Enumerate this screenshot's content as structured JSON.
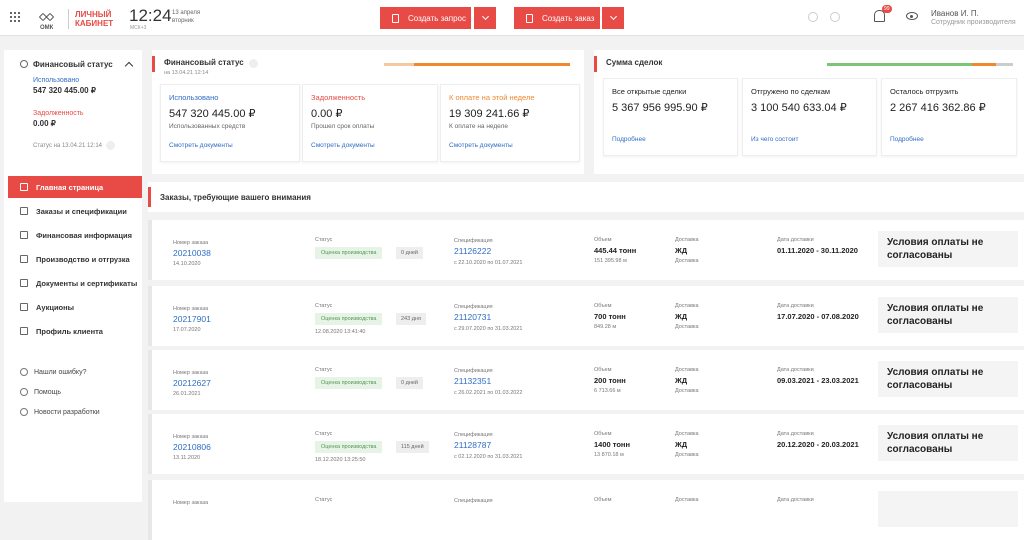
{
  "header": {
    "logo_text": "ОМК",
    "logo_title_line1": "ЛИЧНЫЙ",
    "logo_title_line2": "КАБИНЕТ",
    "time": "12:24",
    "date_line1": "13 апреля",
    "date_line2": "вторник",
    "timezone": "МСК+3",
    "create_request": "Создать запрос",
    "create_order": "Создать заказ",
    "notif_count": "99",
    "user_name": "Иванов И. П.",
    "user_role": "Сотрудник производителя",
    "accent": "#e84a45"
  },
  "sidebar": {
    "fin_title": "Финансовый статус",
    "used_label": "Использовано",
    "used_value": "547 320 445.00 ₽",
    "debt_label": "Задолженность",
    "debt_value": "0.00 ₽",
    "status_text": "Статус на 13.04.21 12:14",
    "nav": [
      {
        "label": "Главная страница"
      },
      {
        "label": "Заказы и спецификации"
      },
      {
        "label": "Финансовая информация"
      },
      {
        "label": "Производство и отгрузка"
      },
      {
        "label": "Документы и сертификаты"
      },
      {
        "label": "Аукционы"
      },
      {
        "label": "Профиль клиента"
      }
    ],
    "secondary": [
      {
        "label": "Нашли ошибку?"
      },
      {
        "label": "Помощь"
      },
      {
        "label": "Новости разработки"
      }
    ]
  },
  "fin_card": {
    "title": "Финансовый статус",
    "subtitle": "на 13.04.21 12:14",
    "blocks": [
      {
        "label": "Использовано",
        "value": "547 320 445.00 ₽",
        "desc": "Использованных средств",
        "link": "Смотреть документы",
        "color": "#2f6ec4"
      },
      {
        "label": "Задолженность",
        "value": "0.00 ₽",
        "desc": "Прошел срок оплаты",
        "link": "Смотреть документы",
        "color": "#e84a45"
      },
      {
        "label": "К оплате на этой неделе",
        "value": "19 309 241.66 ₽",
        "desc": "К оплате на неделе",
        "link": "Смотреть документы",
        "color": "#f0892e"
      }
    ]
  },
  "deals_card": {
    "title": "Сумма сделок",
    "blocks": [
      {
        "label": "Все открытые сделки",
        "value": "5 367 956 995.90 ₽",
        "link": "Подробнее"
      },
      {
        "label": "Отгружено по сделкам",
        "value": "3 100 540 633.04 ₽",
        "link": "Из чего состоит"
      },
      {
        "label": "Осталось отгрузить",
        "value": "2 267 416 362.86 ₽",
        "link": "Подробнее"
      }
    ]
  },
  "orders": {
    "title": "Заказы, требующие вашего внимания",
    "labels": {
      "order": "Номер заказа",
      "status": "Статус",
      "spec": "Спецификация",
      "volume": "Объем",
      "delivery": "Доставка",
      "delivery_date": "Дата доставки"
    },
    "rows": [
      {
        "order": "20210038",
        "order_date": "14.10.2020",
        "status": "Оценка производства",
        "days": "0 дней",
        "status_date": "",
        "spec": "21126222",
        "spec_period": "с 22.10.2020 по 01.07.2021",
        "volume": "445.44 тонн",
        "volume_sub": "151 395.98 м",
        "delivery": "ЖД",
        "delivery_sub": "Доставка",
        "date_range": "01.11.2020 - 30.11.2020",
        "cond1": "Условия оплаты не",
        "cond2": "согласованы"
      },
      {
        "order": "20217901",
        "order_date": "17.07.2020",
        "status": "Оценка производства",
        "days": "243 дня",
        "status_date": "12.08.2020 13:41:40",
        "spec": "21120731",
        "spec_period": "с 29.07.2020 по 31.03.2021",
        "volume": "700 тонн",
        "volume_sub": "849.28 м",
        "delivery": "ЖД",
        "delivery_sub": "Доставка",
        "date_range": "17.07.2020 - 07.08.2020",
        "cond1": "Условия оплаты не",
        "cond2": "согласованы"
      },
      {
        "order": "20212627",
        "order_date": "26.01.2021",
        "status": "Оценка производства",
        "days": "0 дней",
        "status_date": "",
        "spec": "21132351",
        "spec_period": "с 26.02.2021 по 01.03.2022",
        "volume": "200 тонн",
        "volume_sub": "6 713.66 м",
        "delivery": "ЖД",
        "delivery_sub": "Доставка",
        "date_range": "09.03.2021 - 23.03.2021",
        "cond1": "Условия оплаты не",
        "cond2": "согласованы"
      },
      {
        "order": "20210806",
        "order_date": "13.11.2020",
        "status": "Оценка производства",
        "days": "115 дней",
        "status_date": "18.12.2020 13:25:50",
        "spec": "21128787",
        "spec_period": "с 02.12.2020 по 31.03.2021",
        "volume": "1400 тонн",
        "volume_sub": "13 870.18 м",
        "delivery": "ЖД",
        "delivery_sub": "Доставка",
        "date_range": "20.12.2020 - 20.03.2021",
        "cond1": "Условия оплаты не",
        "cond2": "согласованы"
      },
      {
        "order": "",
        "order_date": "",
        "status": "",
        "days": "",
        "status_date": "",
        "spec": "",
        "spec_period": "",
        "volume": "",
        "volume_sub": "",
        "delivery": "",
        "delivery_sub": "",
        "date_range": "",
        "cond1": "",
        "cond2": ""
      }
    ]
  }
}
